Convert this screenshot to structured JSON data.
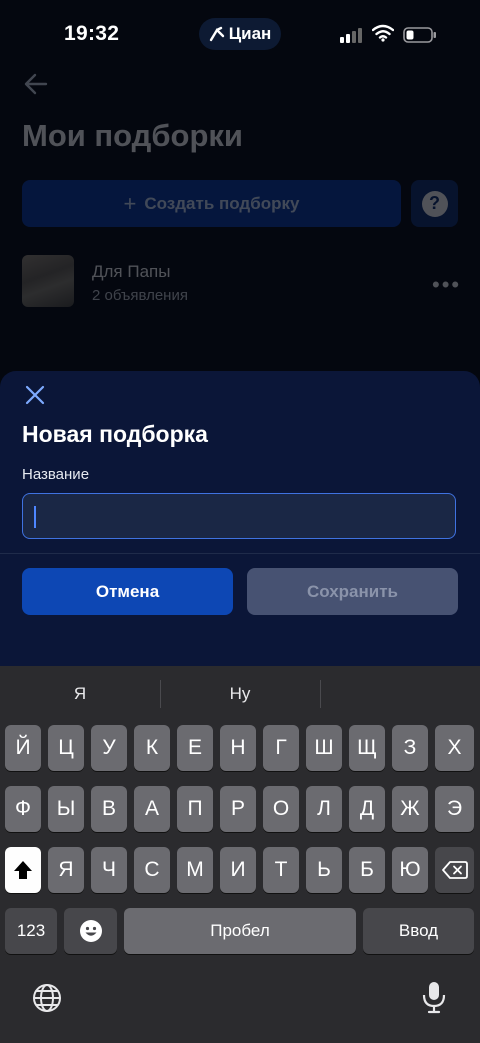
{
  "status_bar": {
    "time": "19:32",
    "island_label": "Циан"
  },
  "header": {
    "title": "Мои подборки"
  },
  "actions": {
    "create_label": "Создать подборку",
    "help_glyph": "?"
  },
  "collection": {
    "name": "Для Папы",
    "count": "2 объявления"
  },
  "sheet": {
    "title": "Новая подборка",
    "field_label": "Название",
    "field_value": "",
    "cancel_label": "Отмена",
    "save_label": "Сохранить"
  },
  "keyboard": {
    "suggestions": [
      "Я",
      "Ну",
      ""
    ],
    "row1": [
      "Й",
      "Ц",
      "У",
      "К",
      "Е",
      "Н",
      "Г",
      "Ш",
      "Щ",
      "З",
      "Х"
    ],
    "row2": [
      "Ф",
      "Ы",
      "В",
      "А",
      "П",
      "Р",
      "О",
      "Л",
      "Д",
      "Ж",
      "Э"
    ],
    "row3": [
      "Я",
      "Ч",
      "С",
      "М",
      "И",
      "Т",
      "Ь",
      "Б",
      "Ю"
    ],
    "numbers_label": "123",
    "space_label": "Пробел",
    "return_label": "Ввод"
  },
  "colors": {
    "primary": "#0d47b4",
    "sheet_bg": "#0b1638",
    "input_border": "#3f72e0",
    "disabled_button": "#475272"
  },
  "icons": [
    "back-arrow-icon",
    "plus-icon",
    "help-icon",
    "more-icon",
    "close-icon",
    "shift-icon",
    "backspace-icon",
    "emoji-icon",
    "globe-icon",
    "microphone-icon",
    "wifi-icon",
    "battery-icon",
    "signal-icon"
  ]
}
